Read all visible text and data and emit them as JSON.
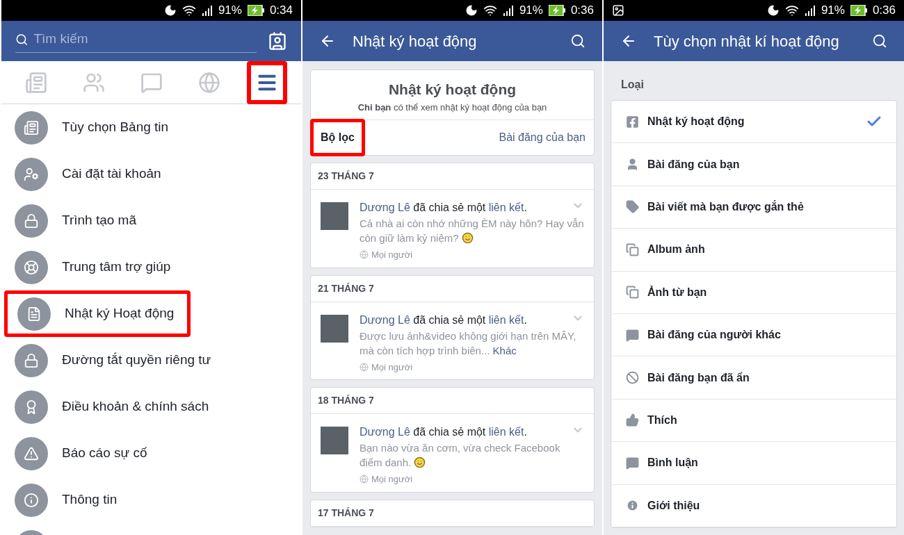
{
  "panels": [
    {
      "kind": "menu",
      "status_bar": {
        "notification": false,
        "battery": "91%",
        "time": "0:34"
      },
      "search": {
        "placeholder": "Tìm kiếm"
      },
      "tabs": [
        {
          "kind": "feed",
          "selected": false,
          "highlight": false
        },
        {
          "kind": "friends",
          "selected": false,
          "highlight": false
        },
        {
          "kind": "messages",
          "selected": false,
          "highlight": false
        },
        {
          "kind": "globe",
          "selected": false,
          "highlight": false
        },
        {
          "kind": "menu",
          "selected": true,
          "highlight": true
        }
      ],
      "items": [
        {
          "kind": "feed",
          "label": "Tùy chọn Bảng tin",
          "highlight": false
        },
        {
          "kind": "account",
          "label": "Cài đặt tài khoản",
          "highlight": false
        },
        {
          "kind": "lock",
          "label": "Trình tạo mã",
          "highlight": false
        },
        {
          "kind": "help",
          "label": "Trung tâm trợ giúp",
          "highlight": false
        },
        {
          "kind": "log",
          "label": "Nhật ký Hoạt động",
          "highlight": true
        },
        {
          "kind": "lock",
          "label": "Đường tắt quyền riêng tư",
          "highlight": false
        },
        {
          "kind": "award",
          "label": "Điều khoản & chính sách",
          "highlight": false
        },
        {
          "kind": "warning",
          "label": "Báo cáo sự cố",
          "highlight": false
        },
        {
          "kind": "info",
          "label": "Thông tin",
          "highlight": false
        },
        {
          "kind": "blank",
          "highlight": false
        }
      ]
    },
    {
      "kind": "log",
      "status_bar": {
        "notification": false,
        "battery": "91%",
        "time": "0:36"
      },
      "title": "Nhật ký hoạt động",
      "card": {
        "title": "Nhật ký hoạt động",
        "subtitle": "**Chỉ bạn** có thể xem nhật ký hoạt động của bạn",
        "filter": {
          "label": "Bộ lọc",
          "highlight": true
        },
        "link": "Bài đăng của bạn"
      },
      "posts": [
        {
          "date": "23 THÁNG 7",
          "actor": "Dương Lê",
          "verb": " đã chia sẻ một ",
          "object": "liên kết",
          "end": ".",
          "text": "Cả nhà ai còn nhớ những ÈM này hôn? Hay vẫn còn giữ làm kỷ niệm?",
          "emoji": true,
          "privacy": "Mọi người"
        },
        {
          "date": "21 THÁNG 7",
          "actor": "Dương Lê",
          "verb": " đã chia sẻ một ",
          "object": "liên kết",
          "end": ".",
          "text": "Được lưu ảnh&video không giới hạn trên MÂY, mà còn tích hợp trình biên...",
          "more": "Khác",
          "emoji": false,
          "privacy": "Mọi người"
        },
        {
          "date": "18 THÁNG 7",
          "actor": "Dương Lê",
          "verb": " đã chia sẻ một ",
          "object": "liên kết",
          "end": ".",
          "text": "Bạn nào vừa ăn cơm, vừa check Facebook điểm danh.",
          "emoji": true,
          "privacy": "Mọi người"
        },
        {
          "date": "17 THÁNG 7"
        }
      ]
    },
    {
      "kind": "options",
      "status_bar": {
        "notification": true,
        "battery": "91%",
        "time": "0:36"
      },
      "title": "Tùy chọn nhật kí hoạt động",
      "section": "Loại",
      "options": [
        {
          "kind": "facebook",
          "label": "Nhật ký hoạt động",
          "selected": true
        },
        {
          "kind": "user",
          "label": "Bài đăng của bạn",
          "selected": false
        },
        {
          "kind": "tag",
          "label": "Bài viết mà bạn được gắn thẻ",
          "selected": false
        },
        {
          "kind": "album",
          "label": "Album ảnh",
          "selected": false
        },
        {
          "kind": "album",
          "label": "Ảnh từ bạn",
          "selected": false
        },
        {
          "kind": "comment-alert",
          "label": "Bài đăng của người khác",
          "selected": false
        },
        {
          "kind": "hidden",
          "label": "Bài đăng bạn đã ẩn",
          "selected": false
        },
        {
          "kind": "like",
          "label": "Thích",
          "selected": false
        },
        {
          "kind": "comment",
          "label": "Bình luận",
          "selected": false
        },
        {
          "kind": "info",
          "label": "Giới thiệu",
          "selected": false
        }
      ]
    }
  ]
}
